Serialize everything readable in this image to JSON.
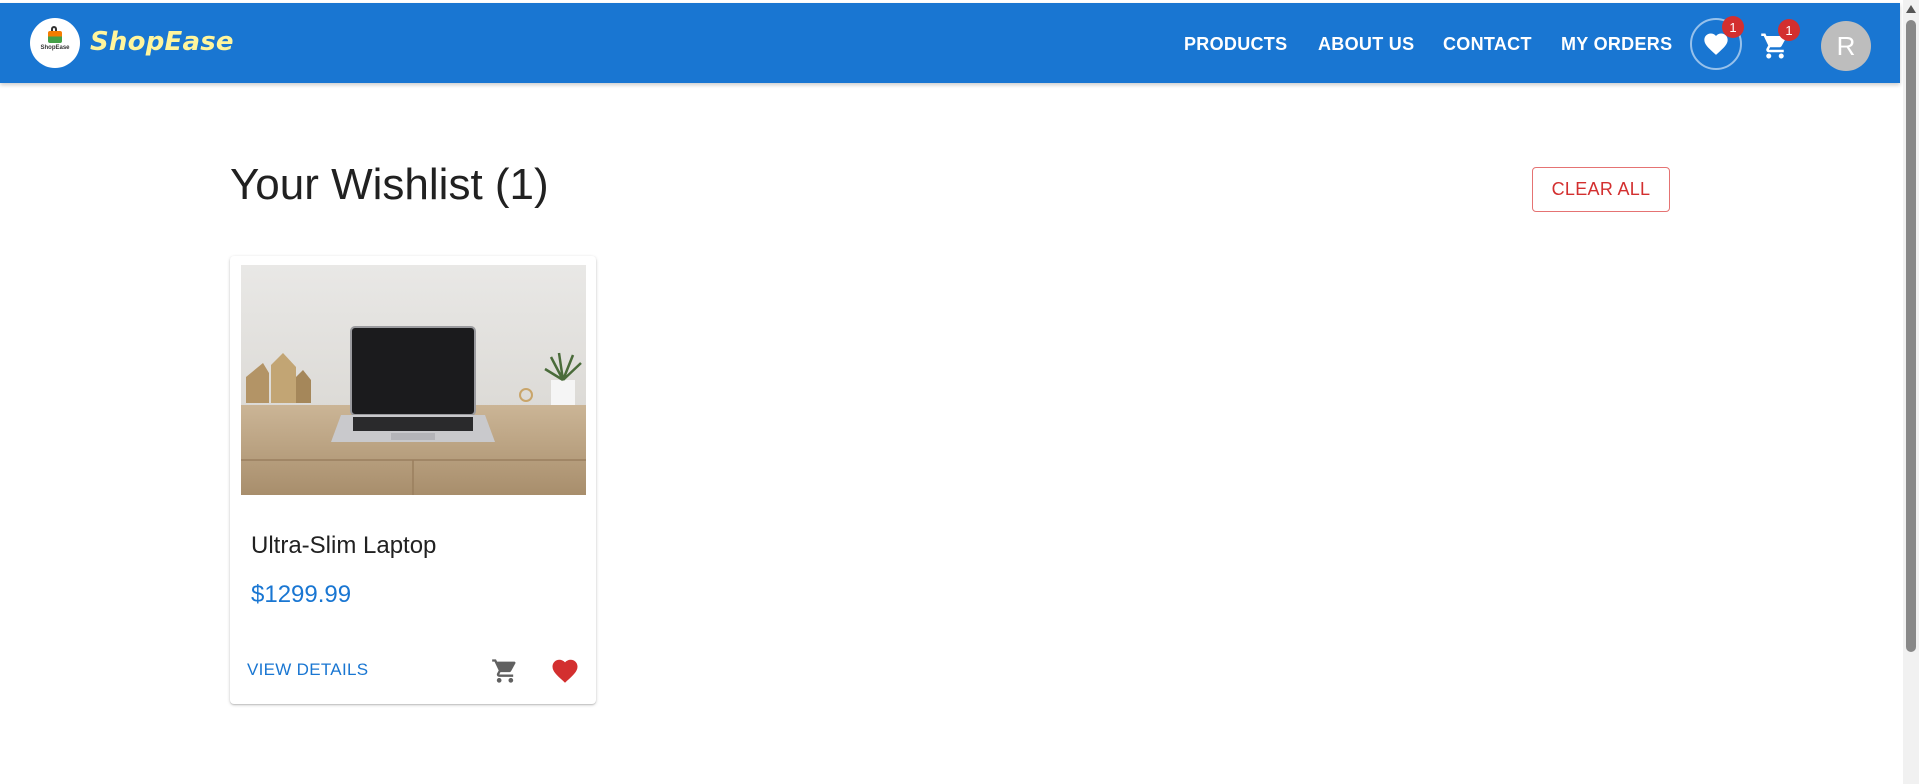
{
  "header": {
    "brand": "ShopEase",
    "logo_text": "ShopEase",
    "nav": [
      "PRODUCTS",
      "ABOUT US",
      "CONTACT",
      "MY ORDERS"
    ],
    "wishlist_count": "1",
    "cart_count": "1",
    "avatar_initial": "R",
    "icons": [
      "heart-icon",
      "cart-icon"
    ]
  },
  "main": {
    "title": "Your Wishlist (1)",
    "clear_all_label": "CLEAR ALL",
    "items": [
      {
        "name": "Ultra-Slim Laptop",
        "price": "$1299.99",
        "view_details_label": "VIEW DETAILS",
        "icons": [
          "cart-icon",
          "heart-icon"
        ]
      }
    ]
  },
  "colors": {
    "appbar": "#1976d2",
    "brand_text": "#fff59d",
    "badge": "#d32f2f",
    "price": "#1976d2",
    "heart": "#d32f2f",
    "clear_all": "#d32f2f"
  }
}
